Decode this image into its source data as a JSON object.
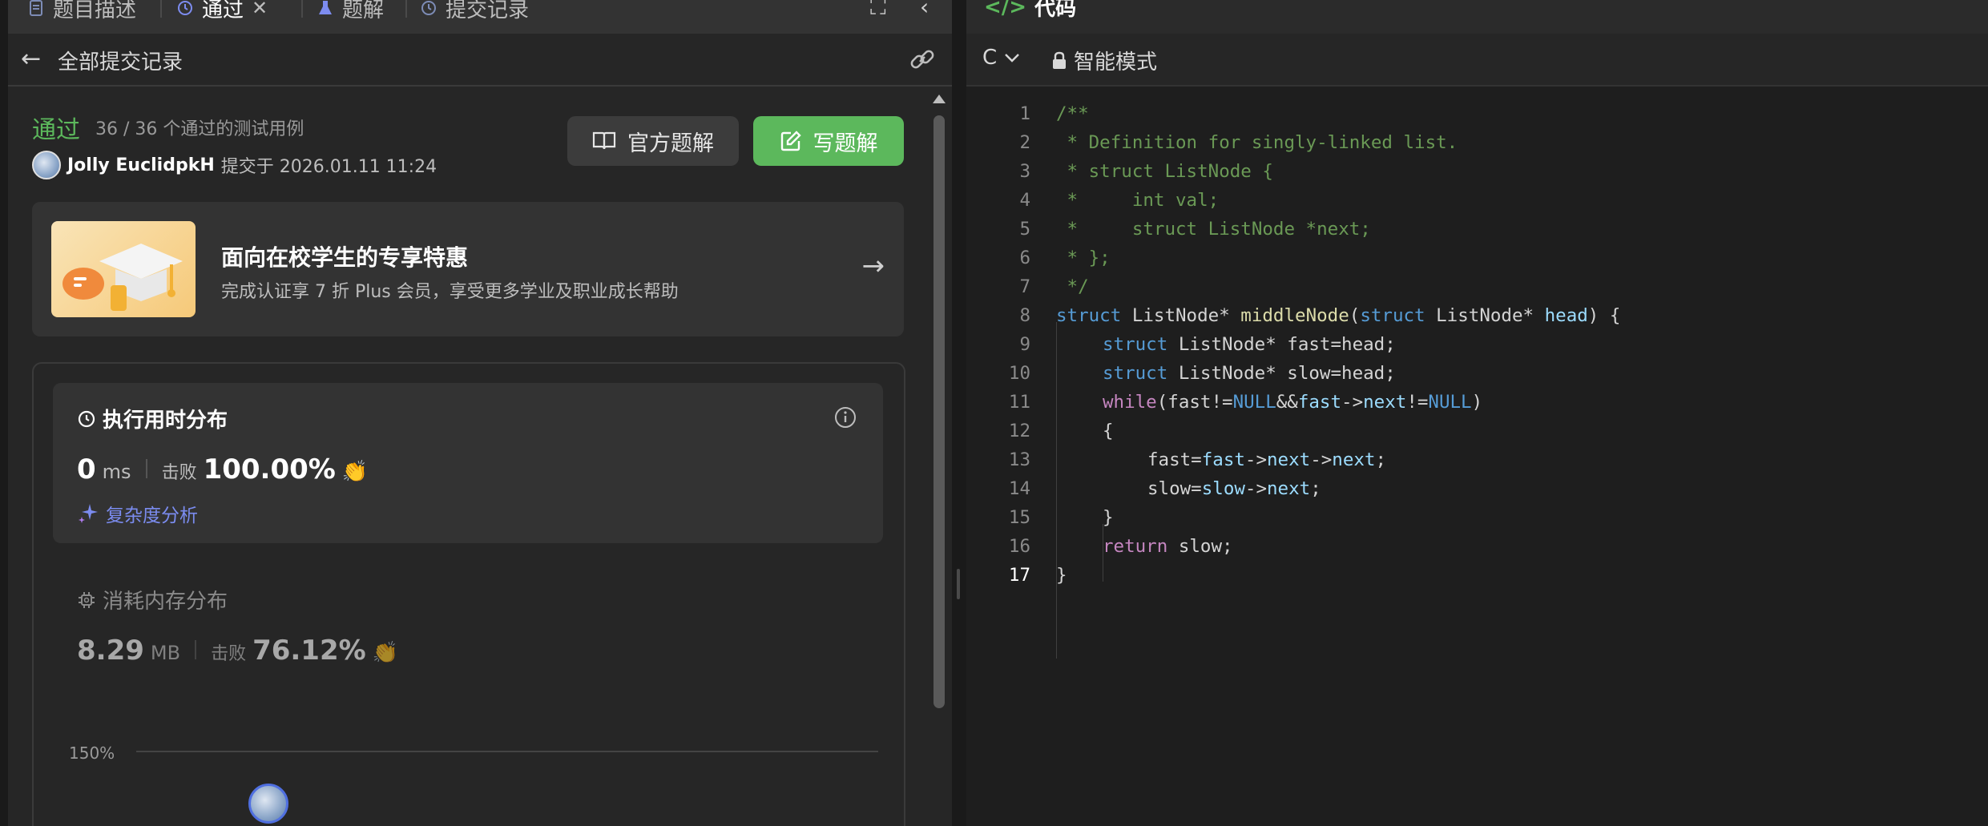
{
  "left_panel": {
    "tabs": [
      {
        "label": "题目描述",
        "icon": "document-icon"
      },
      {
        "label": "通过",
        "icon": "history-icon",
        "active": true,
        "closable": true
      },
      {
        "label": "题解",
        "icon": "flask-icon"
      },
      {
        "label": "提交记录",
        "icon": "history-icon"
      }
    ],
    "subheader": {
      "back_label": "全部提交记录"
    },
    "submission": {
      "status": "通过",
      "cases": "36 / 36 个通过的测试用例",
      "user": "Jolly EuclidpkH",
      "submitted_at": "提交于 2026.01.11 11:24",
      "official_solution_label": "官方题解",
      "write_solution_label": "写题解"
    },
    "promo": {
      "title": "面向在校学生的专享特惠",
      "subtitle": "完成认证享 7 折 Plus 会员，享受更多学业及职业成长帮助"
    },
    "runtime": {
      "title": "执行用时分布",
      "value": "0",
      "unit": "ms",
      "beat_label": "击败",
      "beat_value": "100.00%",
      "complexity_label": "复杂度分析"
    },
    "memory": {
      "title": "消耗内存分布",
      "value": "8.29",
      "unit": "MB",
      "beat_label": "击败",
      "beat_value": "76.12%"
    },
    "distribution_chart": {
      "axis_label": "150%"
    }
  },
  "right_panel": {
    "tab_label": "代码",
    "language": "C",
    "mode_label": "智能模式",
    "code_lines": [
      "1",
      "2",
      "3",
      "4",
      "5",
      "6",
      "7",
      "8",
      "9",
      "10",
      "11",
      "12",
      "13",
      "14",
      "15",
      "16",
      "17"
    ],
    "code": {
      "l1": "/**",
      "l2": " * Definition for singly-linked list.",
      "l3": " * struct ListNode {",
      "l4": " *     int val;",
      "l5": " *     struct ListNode *next;",
      "l6": " * };",
      "l7": " */",
      "l8_kw": "struct",
      "l8_a": " ListNode* ",
      "l8_fn": "middleNode",
      "l8_b": "(",
      "l8_kw2": "struct",
      "l8_c": " ListNode* ",
      "l8_var": "head",
      "l8_d": ") {",
      "l9_kw": "struct",
      "l9_rest": " ListNode* fast=head;",
      "l10_kw": "struct",
      "l10_rest": " ListNode* slow=head;",
      "l11_kw": "while",
      "l11_a": "(fast!=",
      "l11_null": "NULL",
      "l11_b": "&&",
      "l11_var": "fast",
      "l11_c": "->",
      "l11_var2": "next",
      "l11_d": "!=",
      "l11_null2": "NULL",
      "l11_e": ")",
      "l12": "{",
      "l13_a": "fast=",
      "l13_var": "fast",
      "l13_b": "->",
      "l13_var2": "next",
      "l13_c": "->",
      "l13_var3": "next",
      "l13_d": ";",
      "l14_a": "slow=",
      "l14_var": "slow",
      "l14_b": "->",
      "l14_var2": "next",
      "l14_c": ";",
      "l15": "}",
      "l16_kw": "return",
      "l16_rest": " slow;",
      "l17": "}"
    }
  },
  "colors": {
    "accent_green": "#5cb85c",
    "accent_blue": "#7b8cf0",
    "background": "#1a1a1a"
  }
}
